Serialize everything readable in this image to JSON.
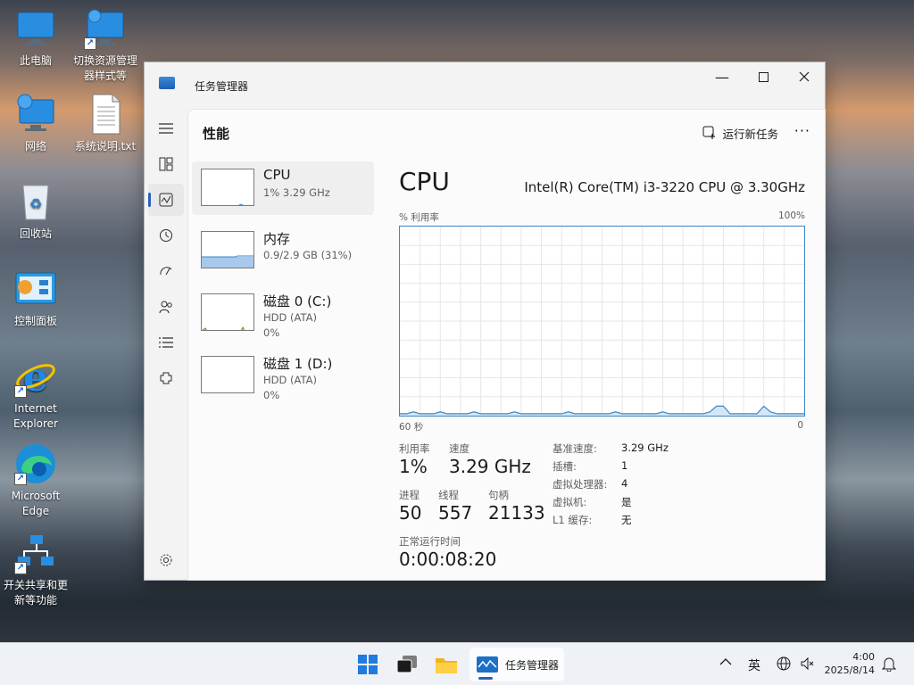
{
  "desktop": {
    "icons": [
      {
        "label": "此电脑"
      },
      {
        "label": "切换资源管理器样式等"
      },
      {
        "label": "网络"
      },
      {
        "label": "系统说明.txt"
      },
      {
        "label": "回收站"
      },
      {
        "label": "控制面板"
      },
      {
        "label": "Internet Explorer"
      },
      {
        "label": "Microsoft Edge"
      },
      {
        "label": "开关共享和更新等功能"
      }
    ]
  },
  "window": {
    "title": "任务管理器",
    "page_title": "性能",
    "run_new_task": "运行新任务",
    "more": "···",
    "rail_icons": [
      "hamburger-icon",
      "processes-icon",
      "performance-icon",
      "history-icon",
      "startup-icon",
      "users-icon",
      "details-icon",
      "services-icon",
      "settings-icon"
    ]
  },
  "perf_list": [
    {
      "name": "CPU",
      "sub1": "1% 3.29 GHz",
      "sub2": ""
    },
    {
      "name": "内存",
      "sub1": "0.9/2.9 GB (31%)",
      "sub2": ""
    },
    {
      "name": "磁盘 0 (C:)",
      "sub1": "HDD (ATA)",
      "sub2": "0%"
    },
    {
      "name": "磁盘 1 (D:)",
      "sub1": "HDD (ATA)",
      "sub2": "0%"
    }
  ],
  "detail": {
    "title": "CPU",
    "model": "Intel(R) Core(TM) i3-3220 CPU @ 3.30GHz",
    "y_label": "% 利用率",
    "y_max": "100%",
    "x_left": "60 秒",
    "x_right": "0",
    "stats": {
      "utilization_label": "利用率",
      "utilization": "1%",
      "speed_label": "速度",
      "speed": "3.29 GHz",
      "processes_label": "进程",
      "processes": "50",
      "threads_label": "线程",
      "threads": "557",
      "handles_label": "句柄",
      "handles": "21133",
      "uptime_label": "正常运行时间",
      "uptime": "0:00:08:20"
    },
    "specs": [
      {
        "key": "基准速度:",
        "value": "3.29 GHz"
      },
      {
        "key": "插槽:",
        "value": "1"
      },
      {
        "key": "虚拟处理器:",
        "value": "4"
      },
      {
        "key": "虚拟机:",
        "value": "是"
      },
      {
        "key": "L1 缓存:",
        "value": "无"
      }
    ]
  },
  "chart_data": {
    "type": "area",
    "title": "CPU",
    "ylabel": "% 利用率",
    "xlabel": "",
    "ylim": [
      0,
      100
    ],
    "x_range_seconds": [
      60,
      0
    ],
    "series": [
      {
        "values": [
          1,
          1,
          2,
          1,
          1,
          1,
          2,
          1,
          1,
          1,
          1,
          2,
          1,
          1,
          1,
          1,
          1,
          2,
          1,
          1,
          1,
          1,
          1,
          1,
          1,
          2,
          1,
          1,
          1,
          1,
          1,
          1,
          2,
          1,
          1,
          1,
          1,
          1,
          1,
          2,
          1,
          1,
          1,
          1,
          1,
          1,
          2,
          5,
          5,
          1,
          1,
          1,
          1,
          1,
          5,
          2,
          1,
          1,
          1,
          1,
          1
        ]
      }
    ],
    "grid": true,
    "color": "#3d85c6"
  },
  "taskbar": {
    "app_label": "任务管理器",
    "ime": "英",
    "time": "4:00",
    "date": "2025/8/14"
  }
}
